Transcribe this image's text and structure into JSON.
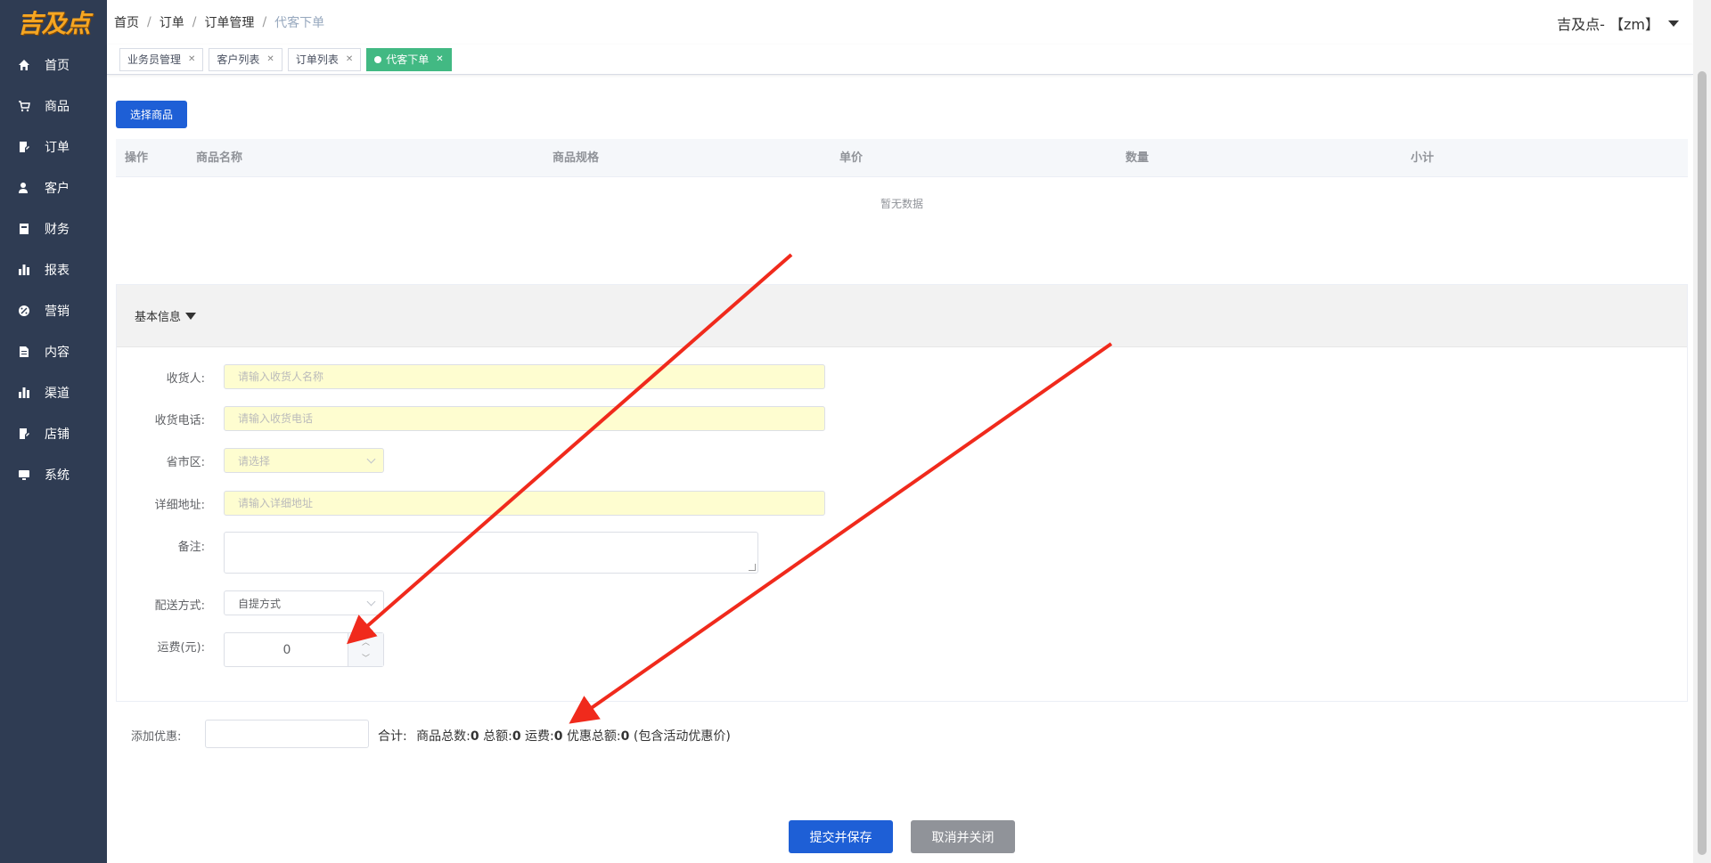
{
  "app": {
    "logo_text": "吉及点"
  },
  "sidebar": {
    "items": [
      {
        "label": "首页",
        "icon": "home-icon"
      },
      {
        "label": "商品",
        "icon": "cart-icon"
      },
      {
        "label": "订单",
        "icon": "order-icon"
      },
      {
        "label": "客户",
        "icon": "customer-icon"
      },
      {
        "label": "财务",
        "icon": "finance-icon"
      },
      {
        "label": "报表",
        "icon": "report-icon"
      },
      {
        "label": "营销",
        "icon": "marketing-icon"
      },
      {
        "label": "内容",
        "icon": "content-icon"
      },
      {
        "label": "渠道",
        "icon": "channel-icon"
      },
      {
        "label": "店铺",
        "icon": "shop-icon"
      },
      {
        "label": "系统",
        "icon": "system-icon"
      }
    ]
  },
  "breadcrumb": [
    "首页",
    "订单",
    "订单管理",
    "代客下单"
  ],
  "user": {
    "name": "吉及点- 【zm】"
  },
  "tags": [
    {
      "label": "业务员管理",
      "active": false
    },
    {
      "label": "客户列表",
      "active": false
    },
    {
      "label": "订单列表",
      "active": false
    },
    {
      "label": "代客下单",
      "active": true
    }
  ],
  "toolbar": {
    "select_goods": "选择商品"
  },
  "table": {
    "headers": [
      "操作",
      "商品名称",
      "商品规格",
      "单价",
      "数量",
      "小计"
    ],
    "empty_text": "暂无数据"
  },
  "basic_info": {
    "title": "基本信息",
    "fields": {
      "receiver_label": "收货人:",
      "receiver_placeholder": "请输入收货人名称",
      "phone_label": "收货电话:",
      "phone_placeholder": "请输入收货电话",
      "region_label": "省市区:",
      "region_placeholder": "请选择",
      "address_label": "详细地址:",
      "address_placeholder": "请输入详细地址",
      "remark_label": "备注:",
      "delivery_label": "配送方式:",
      "delivery_value": "自提方式",
      "freight_label": "运费(元):",
      "freight_value": "0"
    }
  },
  "summary": {
    "discount_label": "添加优惠:",
    "total_label": "合计:",
    "goods_count_label": "商品总数:",
    "goods_count": "0",
    "amount_label": "总额:",
    "amount": "0",
    "freight_label": "运费:",
    "freight": "0",
    "discount_total_label": "优惠总额:",
    "discount_total": "0",
    "note": "(包含活动优惠价)"
  },
  "actions": {
    "submit": "提交并保存",
    "cancel": "取消并关闭"
  },
  "colors": {
    "sidebar_bg": "#2f3c53",
    "primary": "#1e5fd6",
    "active_tag": "#42b983",
    "input_bg": "#fefdd0",
    "annotation_arrow": "#f02a1c"
  }
}
